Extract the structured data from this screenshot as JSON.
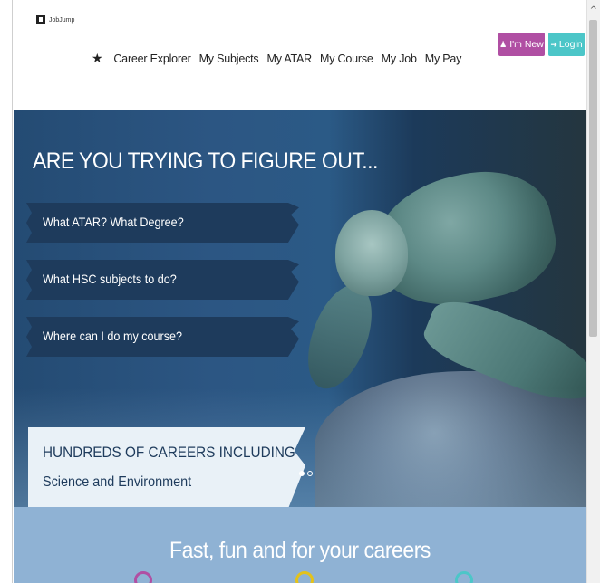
{
  "header": {
    "logo_text": "JobJump",
    "nav": [
      {
        "label": "Career Explorer"
      },
      {
        "label": "My Subjects"
      },
      {
        "label": "My ATAR"
      },
      {
        "label": "My Course"
      },
      {
        "label": "My Job"
      },
      {
        "label": "My Pay"
      }
    ],
    "new_button": "I'm New",
    "login_button": "Login"
  },
  "hero": {
    "title": "ARE YOU TRYING TO FIGURE OUT...",
    "questions": [
      {
        "label": "What ATAR? What Degree?"
      },
      {
        "label": "What HSC subjects to do?"
      },
      {
        "label": "Where can I do my course?"
      }
    ],
    "careers_title": "HUNDREDS OF CAREERS INCLUDING",
    "careers_sub": "Science and Environment",
    "slides": 2,
    "active_slide": 1
  },
  "footer": {
    "title": "Fast, fun and for your careers",
    "circle_colors": [
      "#b04fa3",
      "#e3c21c",
      "#4cc6c8"
    ]
  },
  "colors": {
    "new_button": "#b04fa3",
    "login_button": "#4cc6c8",
    "banner": "#1e3b5c",
    "footer": "#8fb2d4"
  }
}
